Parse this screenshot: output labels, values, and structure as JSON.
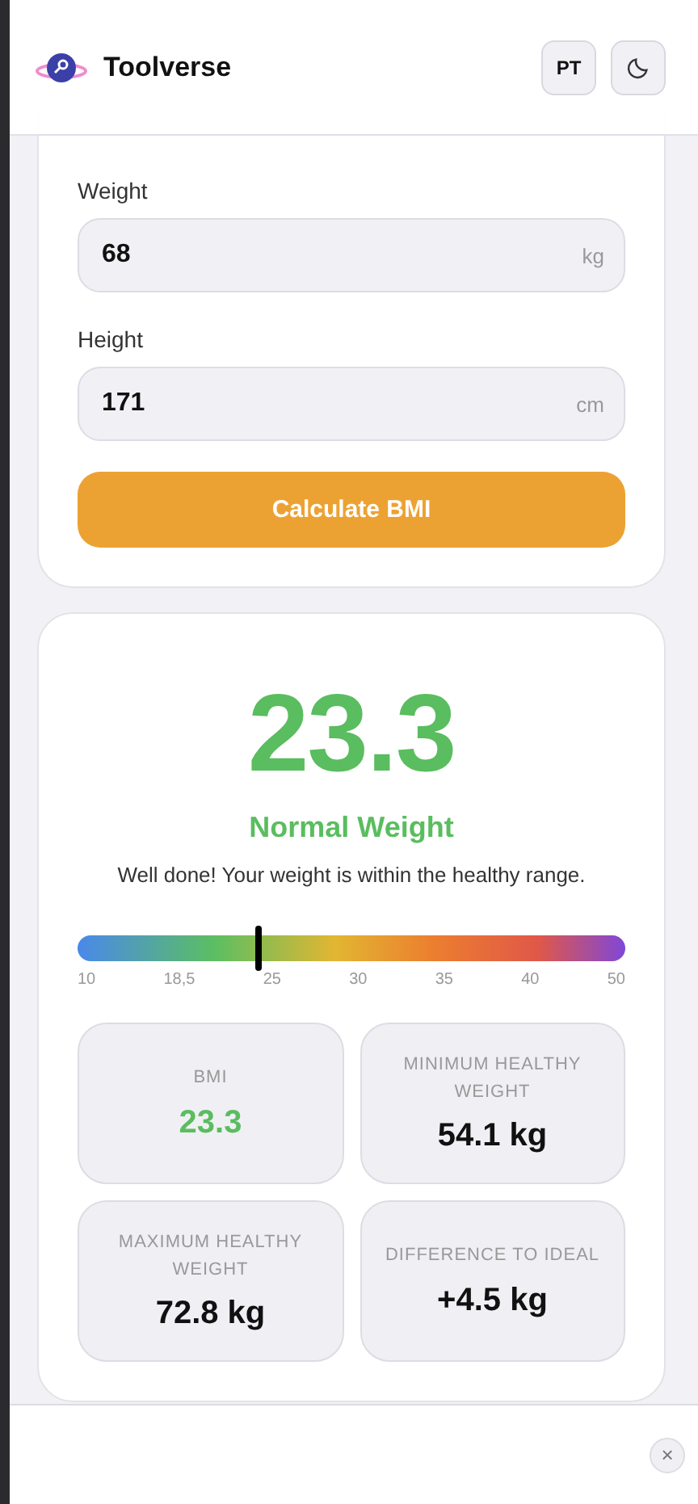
{
  "header": {
    "brand": "Toolverse",
    "language_button": "PT"
  },
  "form": {
    "fields": [
      {
        "label": "Weight",
        "value": "68",
        "unit": "kg"
      },
      {
        "label": "Height",
        "value": "171",
        "unit": "cm"
      }
    ],
    "submit": "Calculate BMI"
  },
  "result": {
    "value": "23.3",
    "category": "Normal Weight",
    "message": "Well done! Your weight is within the healthy range.",
    "scale": {
      "level": 0.33,
      "ticks": [
        "10",
        "18,5",
        "25",
        "30",
        "35",
        "40",
        "50"
      ]
    },
    "stats": [
      {
        "label": "BMI",
        "value": "23.3",
        "highlight": true
      },
      {
        "label": "MINIMUM HEALTHY WEIGHT",
        "value": "54.1 kg",
        "highlight": false
      },
      {
        "label": "MAXIMUM HEALTHY WEIGHT",
        "value": "72.8 kg",
        "highlight": false
      },
      {
        "label": "DIFFERENCE TO IDEAL",
        "value": "+4.5 kg",
        "highlight": false
      }
    ]
  },
  "footer": {
    "close": "×"
  }
}
